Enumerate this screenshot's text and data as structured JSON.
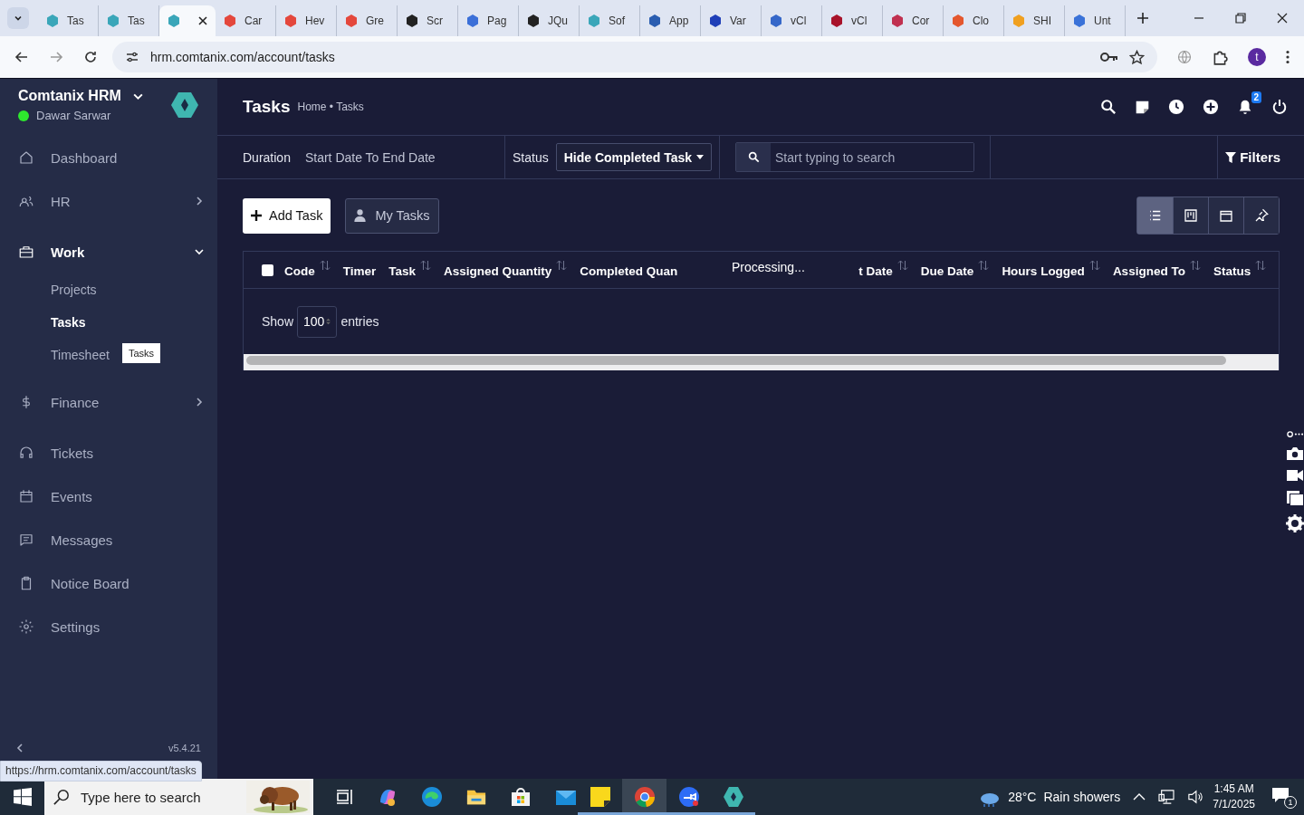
{
  "browser": {
    "tabs": [
      {
        "label": "Tas",
        "selected": false
      },
      {
        "label": "Tas",
        "selected": false
      },
      {
        "selected": true
      },
      {
        "label": "Car",
        "selected": false
      },
      {
        "label": "Hev",
        "selected": false
      },
      {
        "label": "Gre",
        "selected": false
      },
      {
        "label": "Scr",
        "selected": false
      },
      {
        "label": "Pag",
        "selected": false
      },
      {
        "label": "JQu",
        "selected": false
      },
      {
        "label": "Sof",
        "selected": false
      },
      {
        "label": "App",
        "selected": false
      },
      {
        "label": "Var",
        "selected": false
      },
      {
        "label": "vCl",
        "selected": false
      },
      {
        "label": "vCl",
        "selected": false
      },
      {
        "label": "Cor",
        "selected": false
      },
      {
        "label": "Clo",
        "selected": false
      },
      {
        "label": "SHI",
        "selected": false
      },
      {
        "label": "Unt",
        "selected": false
      }
    ],
    "url": "hrm.comtanix.com/account/tasks",
    "profile_initial": "t",
    "link_preview": "https://hrm.comtanix.com/account/tasks"
  },
  "sidebar": {
    "brand": "Comtanix HRM",
    "user": {
      "name": "Dawar Sarwar",
      "online": true
    },
    "items": [
      {
        "label": "Dashboard"
      },
      {
        "label": "HR",
        "expanded": false
      },
      {
        "label": "Work",
        "expanded": true,
        "children": [
          {
            "label": "Projects",
            "selected": false
          },
          {
            "label": "Tasks",
            "selected": true
          },
          {
            "label": "Timesheet",
            "selected": false
          }
        ]
      },
      {
        "label": "Finance",
        "expanded": false
      },
      {
        "label": "Tickets"
      },
      {
        "label": "Events"
      },
      {
        "label": "Messages"
      },
      {
        "label": "Notice Board"
      },
      {
        "label": "Settings"
      }
    ],
    "tooltip": "Tasks",
    "version": "v5.4.21"
  },
  "header": {
    "title": "Tasks",
    "breadcrumb": "Home • Tasks",
    "notification_count": "2"
  },
  "filters": {
    "duration_label": "Duration",
    "duration_value": "Start Date To End Date",
    "status_label": "Status",
    "status_value": "Hide Completed Task",
    "search_placeholder": "Start typing to search",
    "filters_button": "Filters"
  },
  "actions": {
    "add_task": "Add Task",
    "my_tasks": "My Tasks",
    "views": [
      {
        "selected": true
      },
      {
        "selected": false
      },
      {
        "selected": false
      },
      {
        "selected": false
      }
    ]
  },
  "table": {
    "select_all_checked": false,
    "columns": [
      {
        "label": "Code",
        "sortable": true
      },
      {
        "label": "Timer",
        "sortable": false
      },
      {
        "label": "Task",
        "sortable": true
      },
      {
        "label": "Assigned Quantity",
        "sortable": true
      },
      {
        "label": "Completed Quan",
        "sortable": false
      },
      {
        "label": "t Date",
        "sortable": true
      },
      {
        "label": "Due Date",
        "sortable": true
      },
      {
        "label": "Hours Logged",
        "sortable": true
      },
      {
        "label": "Assigned To",
        "sortable": true
      },
      {
        "label": "Status",
        "sortable": true
      }
    ],
    "processing": "Processing...",
    "show_label": "Show",
    "page_length": "100",
    "entries_label": "entries"
  },
  "taskbar": {
    "search_placeholder": "Type here to search",
    "temperature": "28°C",
    "weather": "Rain showers",
    "time": "1:45 AM",
    "date": "7/1/2025",
    "notifications": "1"
  }
}
